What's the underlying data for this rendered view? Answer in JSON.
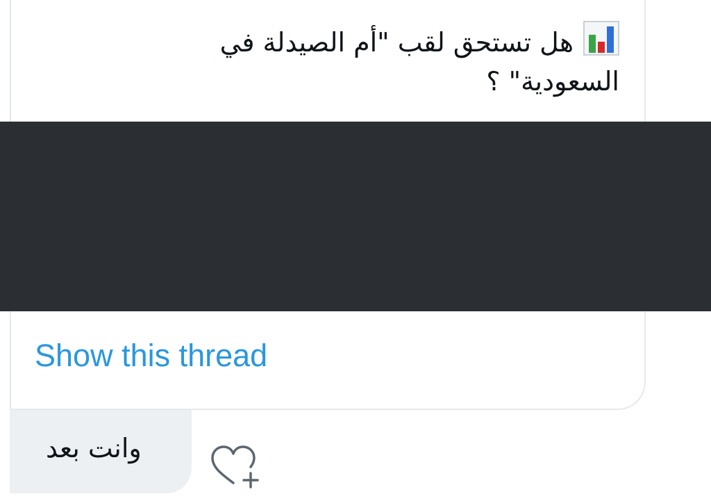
{
  "tweet": {
    "emoji_icon": "bar-chart-icon",
    "text_line1": "هل تستحق لقب \"أم الصيدلة في",
    "text_line2": "السعودية\" ؟",
    "show_thread": "Show this thread"
  },
  "reply": {
    "text": "وانت بعد",
    "like_icon": "heart-plus-icon"
  },
  "colors": {
    "link": "#2a97de",
    "media_background": "#2b2f33",
    "bubble_background": "#edf0f2",
    "text": "#0f1419"
  }
}
